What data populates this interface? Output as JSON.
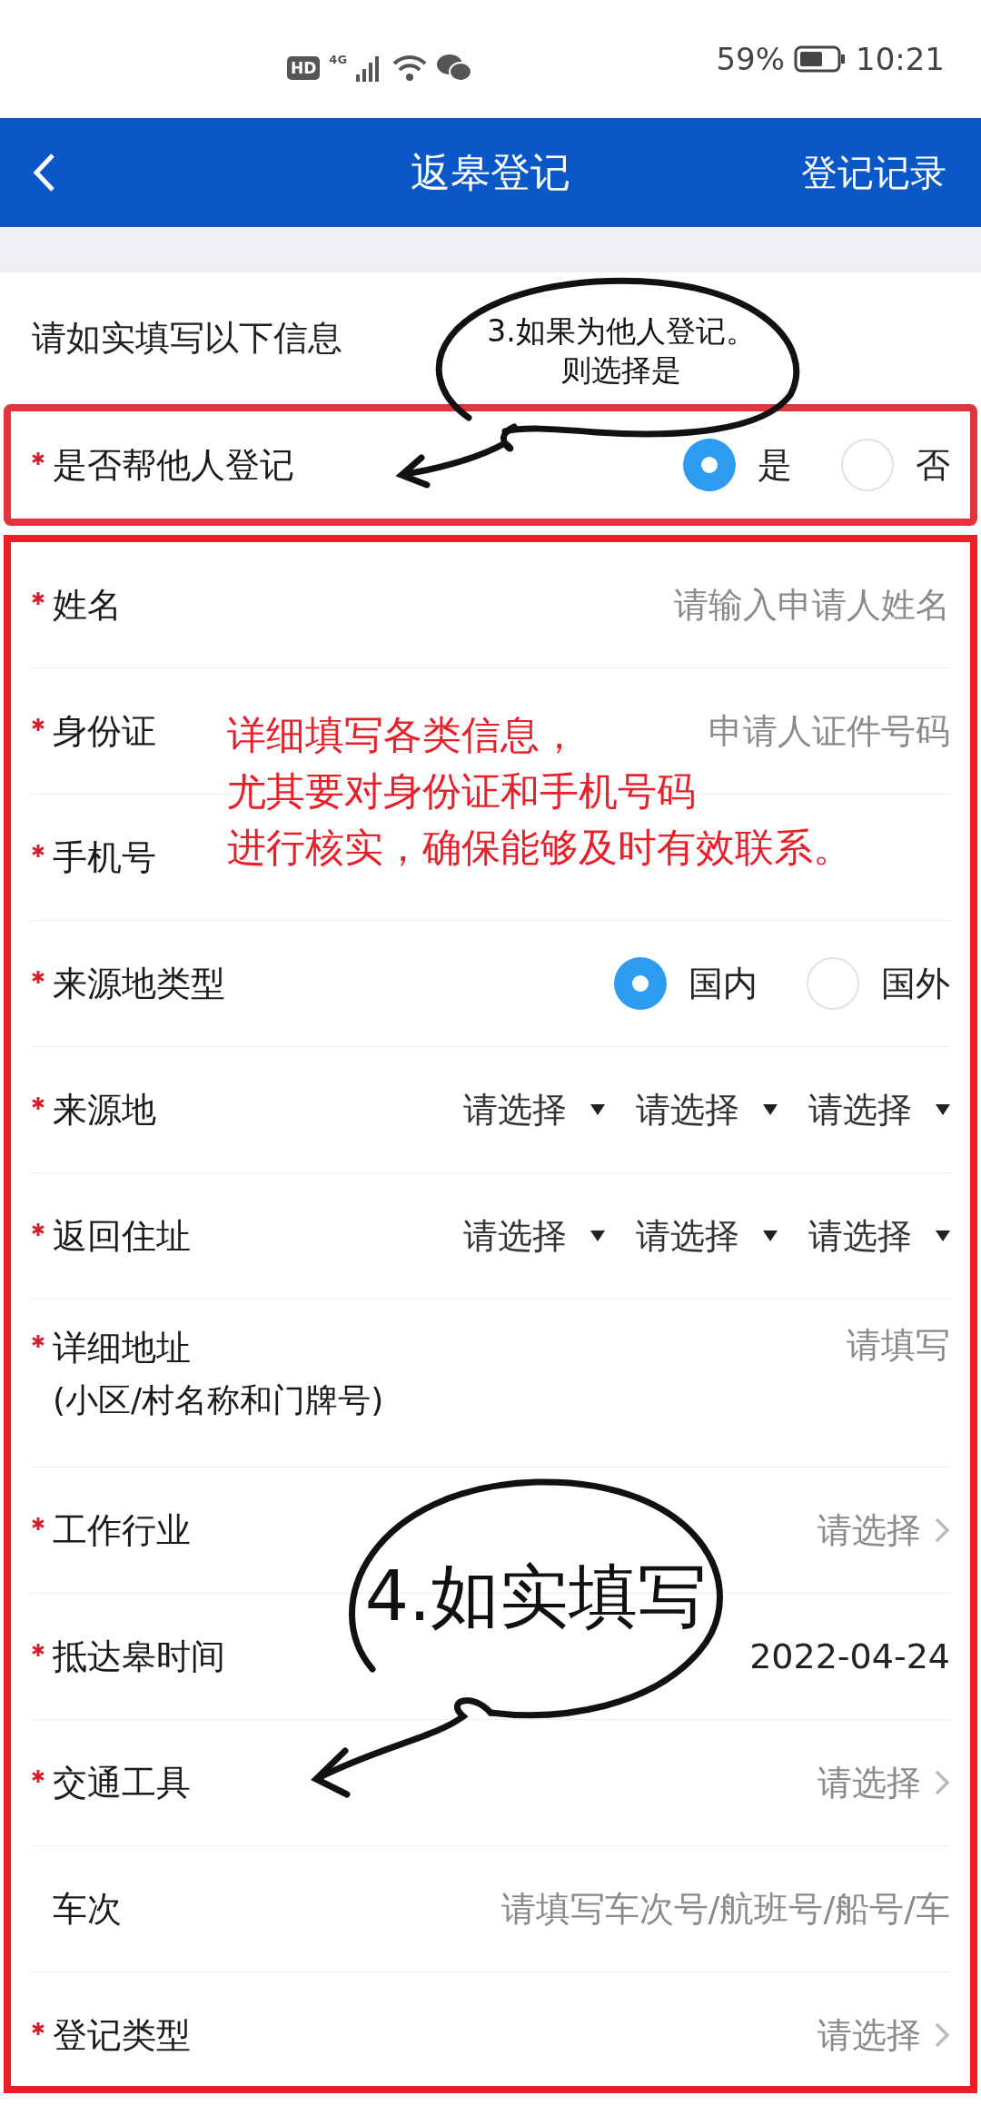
{
  "status_bar": {
    "hd": "HD",
    "network": "4G",
    "battery": "59%",
    "time": "10:21"
  },
  "header": {
    "title": "返皋登记",
    "action": "登记记录"
  },
  "intro": "请如实填写以下信息",
  "helper_question": {
    "label": "是否帮他人登记",
    "required": true,
    "options": [
      {
        "label": "是",
        "selected": true
      },
      {
        "label": "否",
        "selected": false
      }
    ]
  },
  "fields": [
    {
      "kind": "input",
      "label": "姓名",
      "required": true,
      "placeholder": "请输入申请人姓名"
    },
    {
      "kind": "input",
      "label": "身份证",
      "required": true,
      "placeholder": "申请人证件号码"
    },
    {
      "kind": "input",
      "label": "手机号",
      "required": true
    },
    {
      "kind": "radio",
      "label": "来源地类型",
      "required": true,
      "options": [
        {
          "label": "国内",
          "selected": true
        },
        {
          "label": "国外",
          "selected": false
        }
      ]
    },
    {
      "kind": "triple_select",
      "label": "来源地",
      "required": true,
      "selects": [
        "请选择",
        "请选择",
        "请选择"
      ]
    },
    {
      "kind": "triple_select",
      "label": "返回住址",
      "required": true,
      "selects": [
        "请选择",
        "请选择",
        "请选择"
      ]
    },
    {
      "kind": "input",
      "label": "详细地址",
      "sublabel": "(小区/村名称和门牌号)",
      "required": true,
      "placeholder": "请填写"
    },
    {
      "kind": "picker",
      "label": "工作行业",
      "required": true,
      "placeholder": "请选择"
    },
    {
      "kind": "date",
      "label": "抵达皋时间",
      "required": true,
      "value": "2022-04-24"
    },
    {
      "kind": "picker",
      "label": "交通工具",
      "required": true,
      "placeholder": "请选择"
    },
    {
      "kind": "input",
      "label": "车次",
      "required": false,
      "placeholder": "请填写车次号/航班号/船号/车"
    },
    {
      "kind": "picker",
      "label": "登记类型",
      "required": true,
      "placeholder": "请选择"
    }
  ],
  "annotations": {
    "bubble_top": [
      "3.如果为他人登记。",
      "则选择是"
    ],
    "note": [
      "详细填写各类信息，",
      "尤其要对身份证和手机号码",
      "进行核实，确保能够及时有效联系。"
    ],
    "bubble_bottom": "4.如实填写"
  }
}
